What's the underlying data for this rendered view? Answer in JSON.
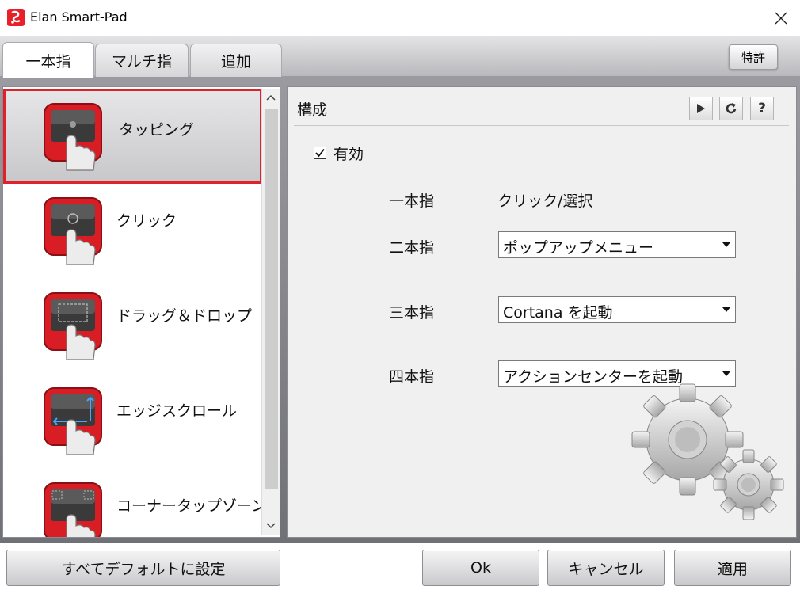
{
  "window": {
    "title": "Elan Smart-Pad",
    "icon": "elan-logo-icon"
  },
  "tabs": [
    {
      "label": "一本指",
      "active": true
    },
    {
      "label": "マルチ指",
      "active": false
    },
    {
      "label": "追加",
      "active": false
    }
  ],
  "patent_label": "特許",
  "features": [
    {
      "label": "タッピング",
      "icon": "tap-gesture-icon",
      "selected": true
    },
    {
      "label": "クリック",
      "icon": "click-gesture-icon",
      "selected": false
    },
    {
      "label": "ドラッグ＆ドロップ",
      "icon": "drag-drop-gesture-icon",
      "selected": false
    },
    {
      "label": "エッジスクロール",
      "icon": "edge-scroll-gesture-icon",
      "selected": false
    },
    {
      "label": "コーナータップゾーン",
      "icon": "corner-tap-gesture-icon",
      "selected": false
    }
  ],
  "panel": {
    "title": "構成",
    "enabled_label": "有効",
    "enabled": true,
    "rows": [
      {
        "label": "一本指",
        "value": "クリック/選択",
        "type": "static"
      },
      {
        "label": "二本指",
        "value": "ポップアップメニュー",
        "type": "select"
      },
      {
        "label": "三本指",
        "value": "Cortana を起動",
        "type": "select"
      },
      {
        "label": "四本指",
        "value": "アクションセンターを起動",
        "type": "select"
      }
    ],
    "toolbar": [
      "play-icon",
      "refresh-icon",
      "help-icon"
    ],
    "help_glyph": "?"
  },
  "buttons": {
    "defaults": "すべてデフォルトに設定",
    "ok": "Ok",
    "cancel": "キャンセル",
    "apply": "適用"
  },
  "colors": {
    "accent_red": "#e0202a",
    "selection_border": "#e0202a"
  }
}
